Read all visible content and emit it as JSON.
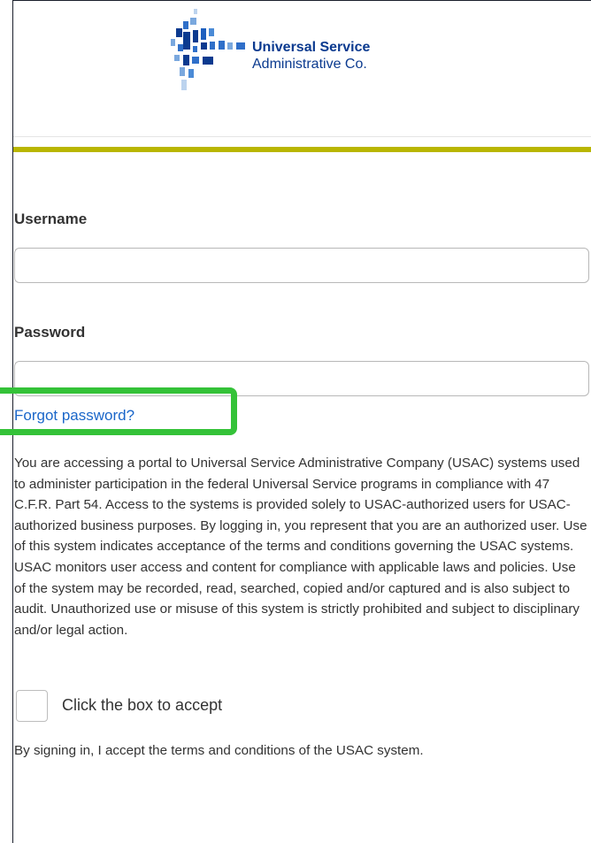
{
  "brand": {
    "line1": "Universal Service",
    "line2": "Administrative Co.",
    "logo_icon": "usac-logo-icon",
    "primary_color": "#0b3a8f",
    "accent_color": "#b9b600"
  },
  "form": {
    "username_label": "Username",
    "username_value": "",
    "password_label": "Password",
    "password_value": "",
    "forgot_password": "Forgot password?",
    "disclaimer": "You are accessing a portal to Universal Service Administrative Company (USAC) systems used to administer participation in the federal Universal Service programs in compliance with 47 C.F.R. Part 54. Access to the systems is provided solely to USAC-authorized users for USAC-authorized business purposes. By logging in, you represent that you are an authorized user. Use of this system indicates acceptance of the terms and conditions governing the USAC systems. USAC monitors user access and content for compliance with applicable laws and policies. Use of the system may be recorded, read, searched, copied and/or captured and is also subject to audit. Unauthorized use or misuse of this system is strictly prohibited and subject to disciplinary and/or legal action.",
    "accept_label": "Click the box to accept",
    "accept_checked": false,
    "signing_note": "By signing in, I accept the terms and conditions of the USAC system."
  },
  "highlight": {
    "target": "forgot-password-link",
    "color": "#34c238"
  }
}
